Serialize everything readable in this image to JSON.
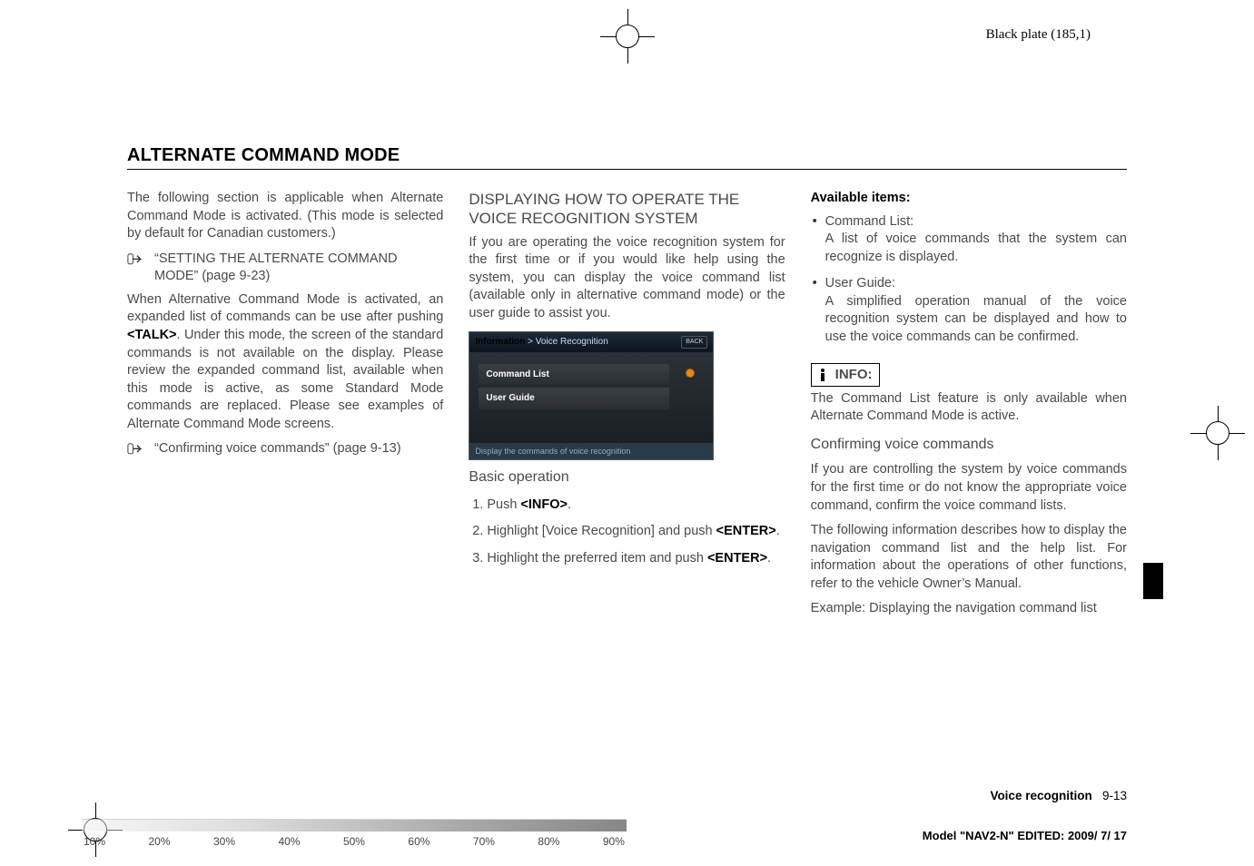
{
  "blackplate": "Black plate (185,1)",
  "section_title": "ALTERNATE COMMAND MODE",
  "col1": {
    "p1": "The following section is applicable when Alternate Command Mode is activated. (This mode is selected by default for Canadian customers.)",
    "hand1": "“SETTING THE ALTERNATE COMMAND MODE” (page 9-23)",
    "p2a": "When Alternative Command Mode is activated, an expanded list of commands can be use after pushing ",
    "p2b": "<TALK>",
    "p2c": ". Under this mode, the screen of the standard commands is not available on the display. Please review the expanded command list, available when this mode is active, as some Standard Mode commands are replaced. Please see examples of Alternate Command Mode screens.",
    "hand2": "“Confirming voice commands” (page 9-13)"
  },
  "col2": {
    "subhead": "DISPLAYING HOW TO OPERATE THE VOICE RECOGNITION SYSTEM",
    "p1": "If you are operating the voice recognition system for the first time or if you would like help using the system, you can display the voice command list (available only in alternative command mode) or the user guide to assist you.",
    "screenshot": {
      "title_prefix": "Information",
      "title_suffix": " > Voice Recognition",
      "back": "BACK",
      "item1": "Command List",
      "item2": "User Guide",
      "footer": "Display the commands of voice recognition"
    },
    "basic": "Basic operation",
    "steps": {
      "s1a": "Push ",
      "s1b": "<INFO>",
      "s1c": ".",
      "s2a": "Highlight [Voice Recognition] and push ",
      "s2b": "<ENTER>",
      "s2c": ".",
      "s3a": "Highlight the preferred item and push ",
      "s3b": "<ENTER>",
      "s3c": "."
    }
  },
  "col3": {
    "avail_head": "Available items:",
    "item1_title": "Command List:",
    "item1_body": "A list of voice commands that the system can recognize is displayed.",
    "item2_title": "User Guide:",
    "item2_body": "A simplified operation manual of the voice recognition system can be displayed and how to use the voice commands can be confirmed.",
    "info_label": "INFO:",
    "info_p": "The Command List feature is only available when Alternate Command Mode is active.",
    "confirm_head": "Confirming voice commands",
    "confirm_p1": "If you are controlling the system by voice commands for the first time or do not know the appropriate voice command, confirm the voice command lists.",
    "confirm_p2": "The following information describes how to display the navigation command list and the help list. For information about the operations of other functions, refer to the vehicle Owner’s Manual.",
    "confirm_p3": "Example: Displaying the navigation command list"
  },
  "footer": {
    "label": "Voice recognition",
    "pageno": "9-13"
  },
  "strip": [
    "10%",
    "20%",
    "30%",
    "40%",
    "50%",
    "60%",
    "70%",
    "80%",
    "90%"
  ],
  "model_line": "Model \"NAV2-N\"  EDITED:  2009/ 7/ 17"
}
